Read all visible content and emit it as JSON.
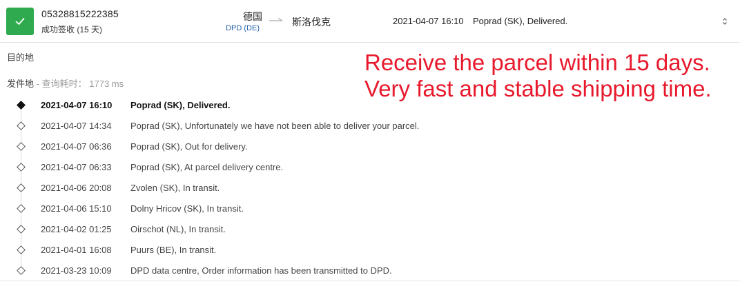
{
  "shipment": {
    "tracking_number": "05328815222385",
    "status_text": "成功签收 (15 天)",
    "status_icon": "check-icon",
    "status_color": "#2faa4f",
    "origin_country": "德国",
    "carrier": "DPD (DE)",
    "destination_country": "斯洛伐克",
    "latest_time": "2021-04-07 16:10",
    "latest_event": "Poprad (SK), Delivered."
  },
  "details": {
    "destination_label": "目的地",
    "origin_label": "发件地",
    "separator": "-",
    "query_time_label": "查询耗时：",
    "query_time_value": "1773 ms"
  },
  "annotation": {
    "line1": "Receive the parcel within 15 days.",
    "line2": "Very fast and stable shipping time.",
    "color": "#e8192c"
  },
  "events": [
    {
      "time": "2021-04-07 16:10",
      "description": "Poprad (SK), Delivered.",
      "current": true
    },
    {
      "time": "2021-04-07 14:34",
      "description": "Poprad (SK), Unfortunately we have not been able to deliver your parcel.",
      "current": false
    },
    {
      "time": "2021-04-07 06:36",
      "description": "Poprad (SK), Out for delivery.",
      "current": false
    },
    {
      "time": "2021-04-07 06:33",
      "description": "Poprad (SK), At parcel delivery centre.",
      "current": false
    },
    {
      "time": "2021-04-06 20:08",
      "description": "Zvolen (SK), In transit.",
      "current": false
    },
    {
      "time": "2021-04-06 15:10",
      "description": "Dolny Hricov (SK), In transit.",
      "current": false
    },
    {
      "time": "2021-04-02 01:25",
      "description": "Oirschot (NL), In transit.",
      "current": false
    },
    {
      "time": "2021-04-01 16:08",
      "description": "Puurs (BE), In transit.",
      "current": false
    },
    {
      "time": "2021-03-23 10:09",
      "description": "DPD data centre, Order information has been transmitted to DPD.",
      "current": false
    }
  ]
}
